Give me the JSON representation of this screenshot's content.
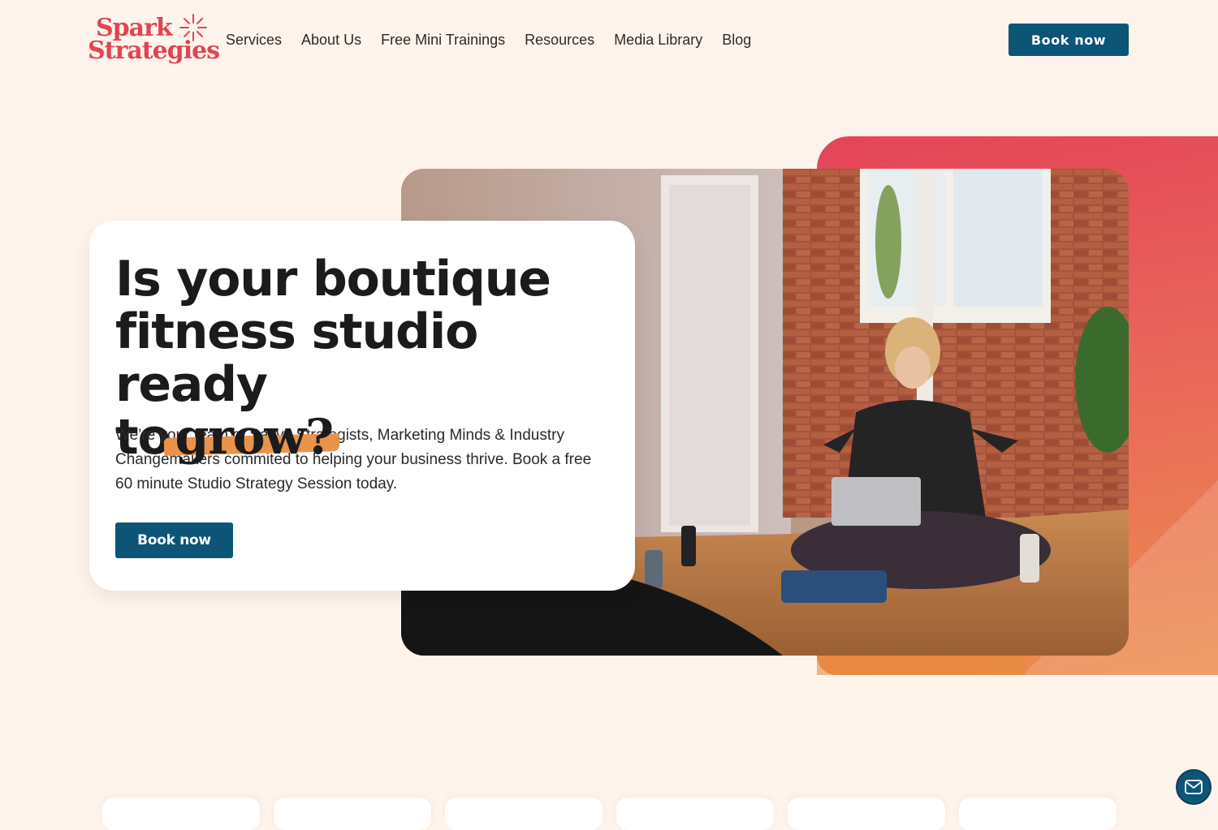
{
  "brand": {
    "line1": "Spark",
    "line2": "Strategies",
    "color": "#e0454f"
  },
  "nav": {
    "items": [
      "Services",
      "About Us",
      "Free Mini Trainings",
      "Resources",
      "Media Library",
      "Blog"
    ]
  },
  "header": {
    "cta_label": "Book now"
  },
  "hero": {
    "headline_line1": "Is your boutique",
    "headline_line2": "fitness studio ready",
    "headline_line3_prefix": "to",
    "headline_accent": "grow?",
    "subtext": "We’re your team of Savvy Strategists, Marketing Minds & Industry Changemakers commited to helping your business thrive. Book a free 60 minute Studio Strategy Session today.",
    "cta_label": "Book now"
  },
  "icons": {
    "logo_burst": "sparkle-burst-icon",
    "chat": "mail-icon"
  },
  "colors": {
    "background": "#fff4ec",
    "primary": "#0d5577",
    "accent_red": "#e44558",
    "accent_orange": "#ec8e4f",
    "highlight": "#e9934a"
  }
}
